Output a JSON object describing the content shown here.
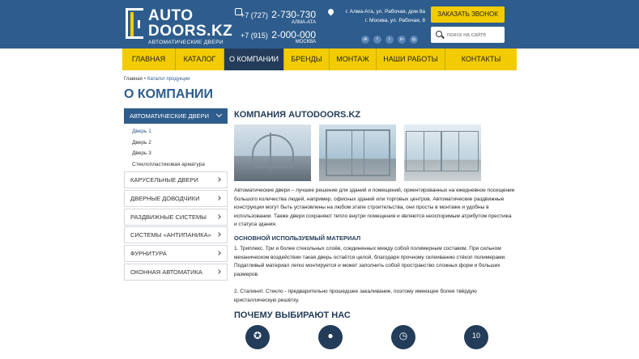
{
  "header": {
    "logo": {
      "line1": "AUTO",
      "line2": "DOORS.KZ",
      "subtitle": "АВТОМАТИЧЕСКИЕ ДВЕРИ"
    },
    "phones": [
      {
        "code": "+7 (727)",
        "number": "2-730-730",
        "city": "АЛМА-АТА"
      },
      {
        "code": "+7 (915)",
        "number": "2-000-000",
        "city": "МОСКВА"
      }
    ],
    "addresses": [
      "г. Алма-Ата, ул. Рабочая, дом 8а",
      "г. Москва, ул. Рабочая, 8"
    ],
    "social": [
      {
        "icon": "vk-icon",
        "label": "vk"
      },
      {
        "icon": "facebook-icon",
        "label": "f"
      },
      {
        "icon": "twitter-icon",
        "label": "t"
      },
      {
        "icon": "linkedin-icon",
        "label": "in"
      },
      {
        "icon": "instagram-icon",
        "label": "ig"
      }
    ],
    "callback_label": "ЗАКАЗАТЬ ЗВОНОК",
    "search_placeholder": "поиск на сайте"
  },
  "nav": {
    "items": [
      {
        "label": "ГЛАВНАЯ"
      },
      {
        "label": "КАТАЛОГ"
      },
      {
        "label": "О КОМПАНИИ",
        "active": true
      },
      {
        "label": "БРЕНДЫ"
      },
      {
        "label": "МОНТАЖ"
      },
      {
        "label": "НАШИ РАБОТЫ"
      },
      {
        "label": "КОНТАКТЫ"
      }
    ]
  },
  "breadcrumb": {
    "home": "Главная",
    "current": "Каталог продукции"
  },
  "page_title": "О КОМПАНИИ",
  "sidebar": {
    "active": "АВТОМАТИЧЕСКИЕ ДВЕРИ",
    "sub_items": [
      "Дверь 1",
      "Дверь 2",
      "Дверь 3",
      "Стеклопластиковая арматура"
    ],
    "items": [
      "КАРУСЕЛЬНЫЕ ДВЕРИ",
      "ДВЕРНЫЕ ДОВОДЧИКИ",
      "РАЗДВИЖНЫЕ СИСТЕМЫ",
      "СИСТЕМЫ «АНТИПАНИКА»",
      "ФУРНИТУРА",
      "ОКОННАЯ АВТОМАТИКА"
    ]
  },
  "content": {
    "heading": "КОМПАНИЯ AUTODOORS.KZ",
    "intro": "Автоматические двери – лучшее решение для зданий и помещений, ориентированных на ежедневное посещение большого количества людей, например, офисных зданий или торговых центров. Автоматические раздвижные конструкции могут быть установлены на любом этапе строительства, они просты в монтаже и удобны в использовании. Также двери сохраняют тепло внутри помещения и являются неоспоримым атрибутом престижа и статуса здания.",
    "material_heading": "ОСНОВНОЙ ИСПОЛЬЗУЕМЫЙ МАТЕРИАЛ",
    "material_1": "1. Триплекс. Три и более стекольных слоёв, соединенных между собой полимерным составом. При сильном механическом воздействии такая дверь остаётся целой, благодаря прочному склеиванию стёкол полимерами. Податливый материал легко монтируется и может заполнить собой пространство сложных форм и больших размеров.",
    "material_2": "2. Сталинит. Стекло - предварительно прошедшее закаливание, поэтому имеющее более твёрдую кристаллическую решётку.",
    "why_heading": "ПОЧЕМУ ВЫБИРАЮТ НАС",
    "badges": [
      {
        "icon": "award-ribbon-icon",
        "glyph": "✪"
      },
      {
        "icon": "person-icon",
        "glyph": "●"
      },
      {
        "icon": "stopwatch-icon",
        "glyph": "◷"
      },
      {
        "icon": "medal-10-icon",
        "glyph": "10"
      }
    ]
  },
  "colors": {
    "primary": "#2e5d8d",
    "accent": "#f2cc00",
    "dark": "#233c5a"
  }
}
